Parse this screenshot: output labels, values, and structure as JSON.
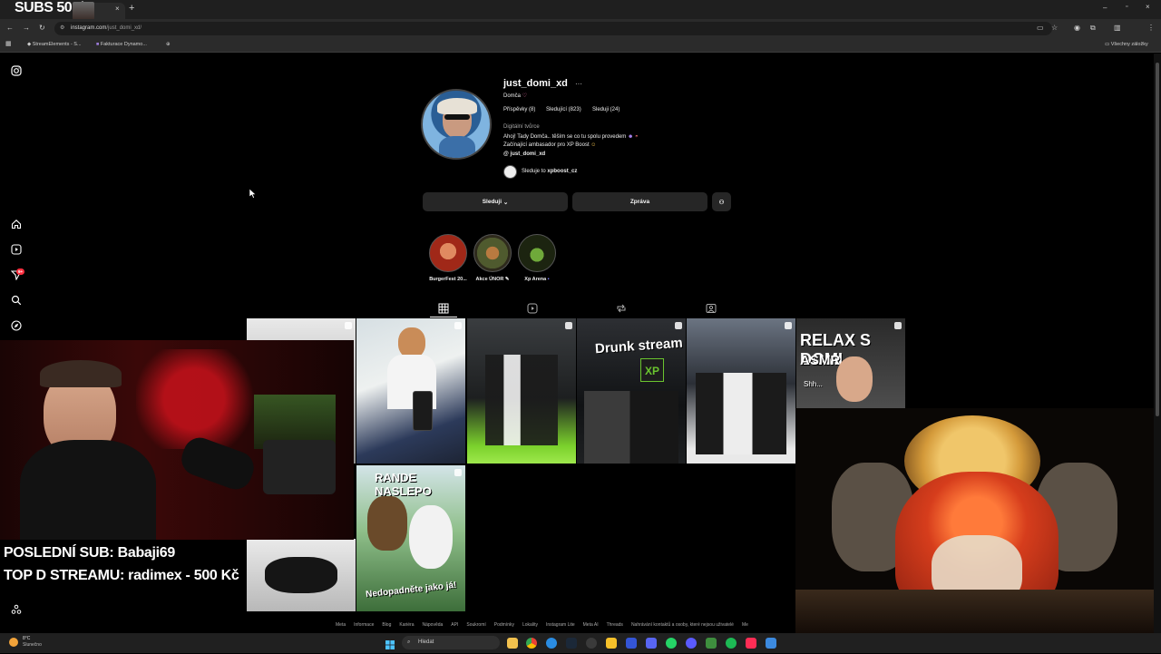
{
  "browser": {
    "subs_overlay": "SUBS 501/",
    "url_host": "instagram.com",
    "url_path": "/just_domi_xd/",
    "bookmarks": [
      "StreamElements - S...",
      "Fakturace Dynamo..."
    ],
    "all_bookmarks": "Všechny záložky"
  },
  "profile": {
    "username": "just_domi_xd",
    "name": "Domča",
    "posts": "Příspěvky (8)",
    "followers": "Sledující (823)",
    "following": "Sleduji (24)",
    "category": "Digitální tvůrce",
    "bio_line1": "Ahoj! Tady Domča.. těším se co tu spolu provedem",
    "bio_line2": "Začínající ambasador pro XP Boost",
    "threads_handle": "just_domi_xd",
    "followed_by_prefix": "Sleduje to",
    "followed_by_account": "xpboost_cz"
  },
  "actions": {
    "following_button": "Sleduji",
    "message_button": "Zpráva"
  },
  "highlights": [
    {
      "label": "BurgerFest 20...",
      "color": "#c0582c"
    },
    {
      "label": "Akce ÚNOR",
      "color": "#6a5a3a"
    },
    {
      "label": "Xp Arena",
      "color": "#3d4a1f"
    }
  ],
  "posts": [
    {
      "title": "Drunk stream"
    },
    {
      "title": "RELAX S DOMI"
    },
    {
      "title": "ASMR"
    },
    {
      "title": "RANDE NASLEPO"
    },
    {
      "title": "Nedopadněte jako já!"
    },
    {
      "title": "Shh..."
    }
  ],
  "footer": [
    "Meta",
    "Informace",
    "Blog",
    "Kariéra",
    "Nápověda",
    "API",
    "Soukromí",
    "Podmínky",
    "Lokality",
    "Instagram Lite",
    "Meta AI",
    "Threads",
    "Nahrávání kontaktů a osoby, které nejsou uživatelé",
    "Me"
  ],
  "stream": {
    "last_sub": "POSLEDNÍ SUB: Babaji69",
    "top_donation": "TOP D STREAMU: radimex - 500 Kč"
  },
  "taskbar": {
    "search_placeholder": "Hledat",
    "weather_temp": "8°C",
    "weather_text": "Slunečno"
  },
  "notifications": {
    "badge": "9+"
  },
  "colors": {
    "background": "#000000",
    "accent_red": "#ff3040",
    "button_bg": "#262626"
  }
}
